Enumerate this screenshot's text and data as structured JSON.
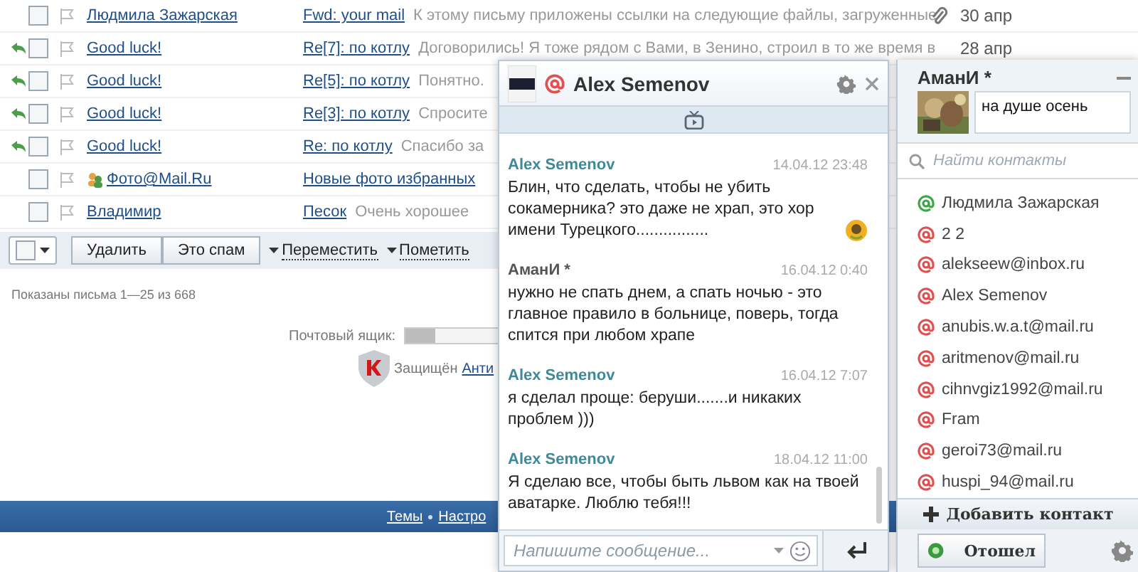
{
  "mail_rows": [
    {
      "checked": false,
      "flagged": false,
      "sender": "Людмила Зажарская",
      "subject": "Fwd: your mail",
      "snippet": "К этому письму приложены ссылки на следующие файлы, загруженные",
      "attachment": true,
      "date": "30 апр"
    },
    {
      "replied": true,
      "checked": false,
      "flagged": false,
      "sender": "Good luck!",
      "subject": "Re[7]: по котлу",
      "snippet": "Договорились! Я тоже рядом с Вами, в Зенино, строил в то же время в",
      "date": "28 апр"
    },
    {
      "replied": true,
      "checked": false,
      "flagged": false,
      "sender": "Good luck!",
      "subject": "Re[5]: по котлу",
      "snippet": "Понятно."
    },
    {
      "replied": true,
      "checked": false,
      "flagged": false,
      "sender": "Good luck!",
      "subject": "Re[3]: по котлу",
      "snippet": "Спросите"
    },
    {
      "replied": true,
      "checked": false,
      "flagged": false,
      "sender": "Good luck!",
      "subject": "Re: по котлу",
      "snippet": "Спасибо за"
    },
    {
      "checked": false,
      "flagged": false,
      "sender": "Фото@Mail.Ru",
      "sender_icon": true,
      "subject": "Новые фото избранных"
    },
    {
      "checked": false,
      "flagged": false,
      "sender": "Владимир",
      "subject": "Песок",
      "snippet": "Очень хорошее"
    }
  ],
  "toolbar": {
    "select_all_checked": false,
    "buttons": [
      "Удалить",
      "Это спам"
    ],
    "menus": [
      "Переместить",
      "Пометить"
    ]
  },
  "summary": "Показаны письма 1—25 из 668",
  "mailbox": {
    "label": "Почтовый ящик:",
    "level": 0.3
  },
  "protection": {
    "text": "Защищён",
    "link": "Анти"
  },
  "footer_links": [
    "Темы",
    "Настро"
  ],
  "chat": {
    "title": "Alex Semenov",
    "messages": [
      {
        "author": "Alex Semenov",
        "color": "#3f8a9a",
        "time": "14.04.12 23:48",
        "text": "Блин, что сделать, чтобы не убить сокамерника? это даже не храп, это хор имени Турецкого................",
        "emoticon": true
      },
      {
        "author": "АманИ *",
        "color": "#555555",
        "time": "16.04.12 0:40",
        "text": "нужно не спать днем, а спать ночью - это главное правило в больнице, поверь, тогда спится при любом храпе"
      },
      {
        "author": "Alex Semenov",
        "color": "#3f8a9a",
        "time": "16.04.12 7:07",
        "text": "я сделал проще: беруши.......и никаких проблем )))"
      },
      {
        "author": "Alex Semenov",
        "color": "#3f8a9a",
        "time": "18.04.12 11:00",
        "text": "Я сделаю все, чтобы быть львом как на твоей аватарке. Люблю тебя!!!"
      }
    ],
    "input": {
      "placeholder": "Напишите сообщение..."
    }
  },
  "contacts_panel": {
    "user": "АманИ *",
    "status_text": "на душе осень",
    "search": {
      "placeholder": "Найти контакты"
    },
    "contacts": [
      {
        "name": "Людмила Зажарская",
        "color": "#3aa844"
      },
      {
        "name": "2 2",
        "color": "#e05050"
      },
      {
        "name": "alekseew@inbox.ru",
        "color": "#e05050"
      },
      {
        "name": "Alex Semenov",
        "color": "#e05050"
      },
      {
        "name": "anubis.w.a.t@mail.ru",
        "color": "#e05050"
      },
      {
        "name": "aritmenov@mail.ru",
        "color": "#e05050"
      },
      {
        "name": "cihnvgiz1992@mail.ru",
        "color": "#e05050"
      },
      {
        "name": "Fram",
        "color": "#e05050"
      },
      {
        "name": "geroi73@mail.ru",
        "color": "#e05050"
      },
      {
        "name": "huspi_94@mail.ru",
        "color": "#e05050"
      }
    ],
    "add_button": "Добавить контакт",
    "status_button": "Отошел"
  }
}
